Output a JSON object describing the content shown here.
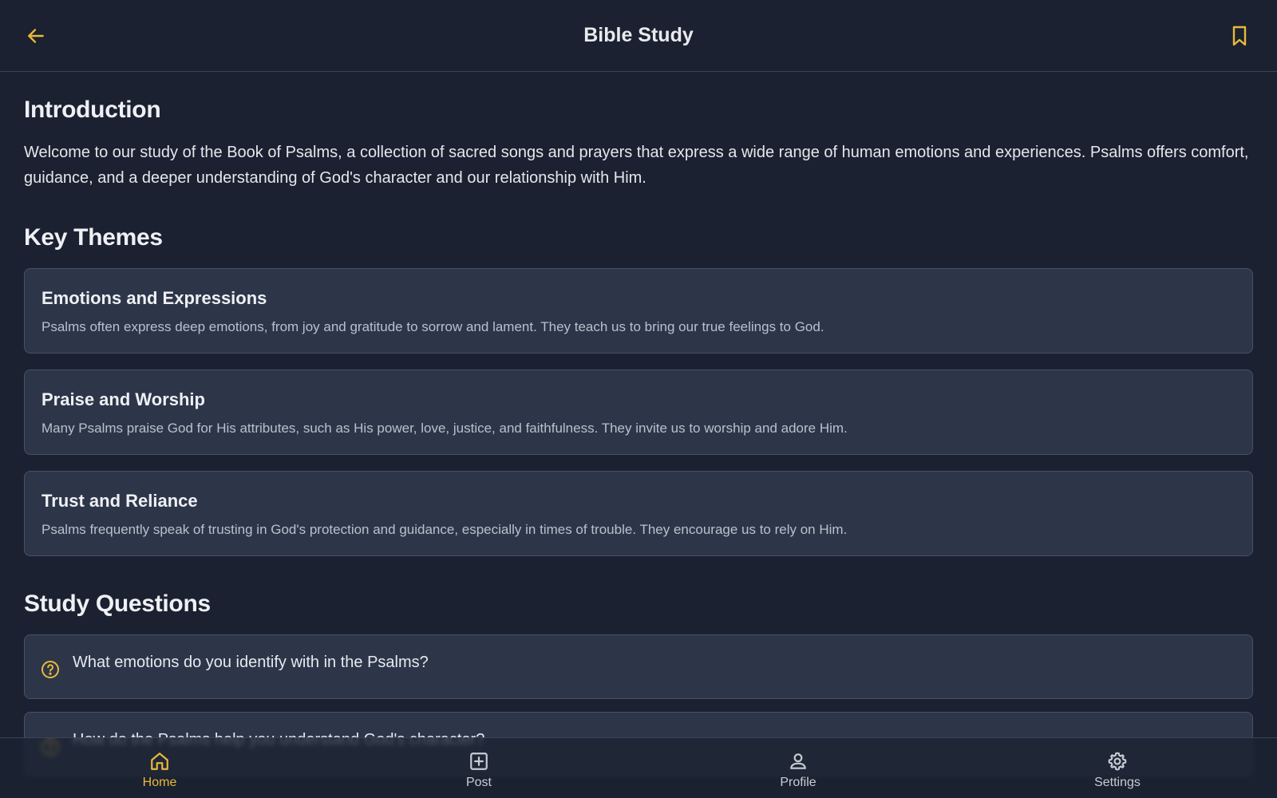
{
  "header": {
    "title": "Bible Study"
  },
  "introduction": {
    "title": "Introduction",
    "text": "Welcome to our study of the Book of Psalms, a collection of sacred songs and prayers that express a wide range of human emotions and experiences. Psalms offers comfort, guidance, and a deeper understanding of God's character and our relationship with Him."
  },
  "key_themes": {
    "title": "Key Themes",
    "items": [
      {
        "title": "Emotions and Expressions",
        "text": "Psalms often express deep emotions, from joy and gratitude to sorrow and lament. They teach us to bring our true feelings to God."
      },
      {
        "title": "Praise and Worship",
        "text": "Many Psalms praise God for His attributes, such as His power, love, justice, and faithfulness. They invite us to worship and adore Him."
      },
      {
        "title": "Trust and Reliance",
        "text": "Psalms frequently speak of trusting in God's protection and guidance, especially in times of trouble. They encourage us to rely on Him."
      }
    ]
  },
  "study_questions": {
    "title": "Study Questions",
    "items": [
      "What emotions do you identify with in the Psalms?",
      "How do the Psalms help you understand God's character?"
    ]
  },
  "bottom_nav": {
    "items": [
      {
        "label": "Home",
        "icon": "home-icon",
        "active": true
      },
      {
        "label": "Post",
        "icon": "plus-square-icon",
        "active": false
      },
      {
        "label": "Profile",
        "icon": "person-icon",
        "active": false
      },
      {
        "label": "Settings",
        "icon": "gear-icon",
        "active": false
      }
    ]
  },
  "colors": {
    "background": "#1b2130",
    "card": "#2d3649",
    "accent": "#e9b93a",
    "text": "#e6e9ef"
  }
}
